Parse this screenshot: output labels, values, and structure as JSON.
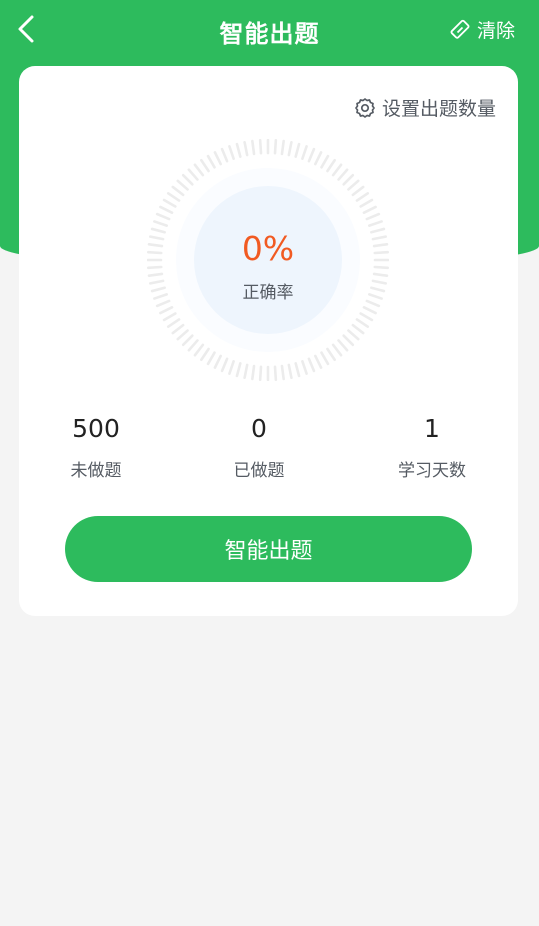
{
  "header": {
    "title": "智能出题",
    "clear_label": "清除"
  },
  "card": {
    "settings_label": "设置出题数量",
    "accuracy": {
      "value": "0%",
      "label": "正确率"
    },
    "stats": [
      {
        "value": "500",
        "label": "未做题"
      },
      {
        "value": "0",
        "label": "已做题"
      },
      {
        "value": "1",
        "label": "学习天数"
      }
    ],
    "start_button": "智能出题"
  },
  "colors": {
    "brand_green": "#2dbb5d",
    "accuracy_orange": "#f15a22",
    "page_bg": "#f4f4f4"
  }
}
